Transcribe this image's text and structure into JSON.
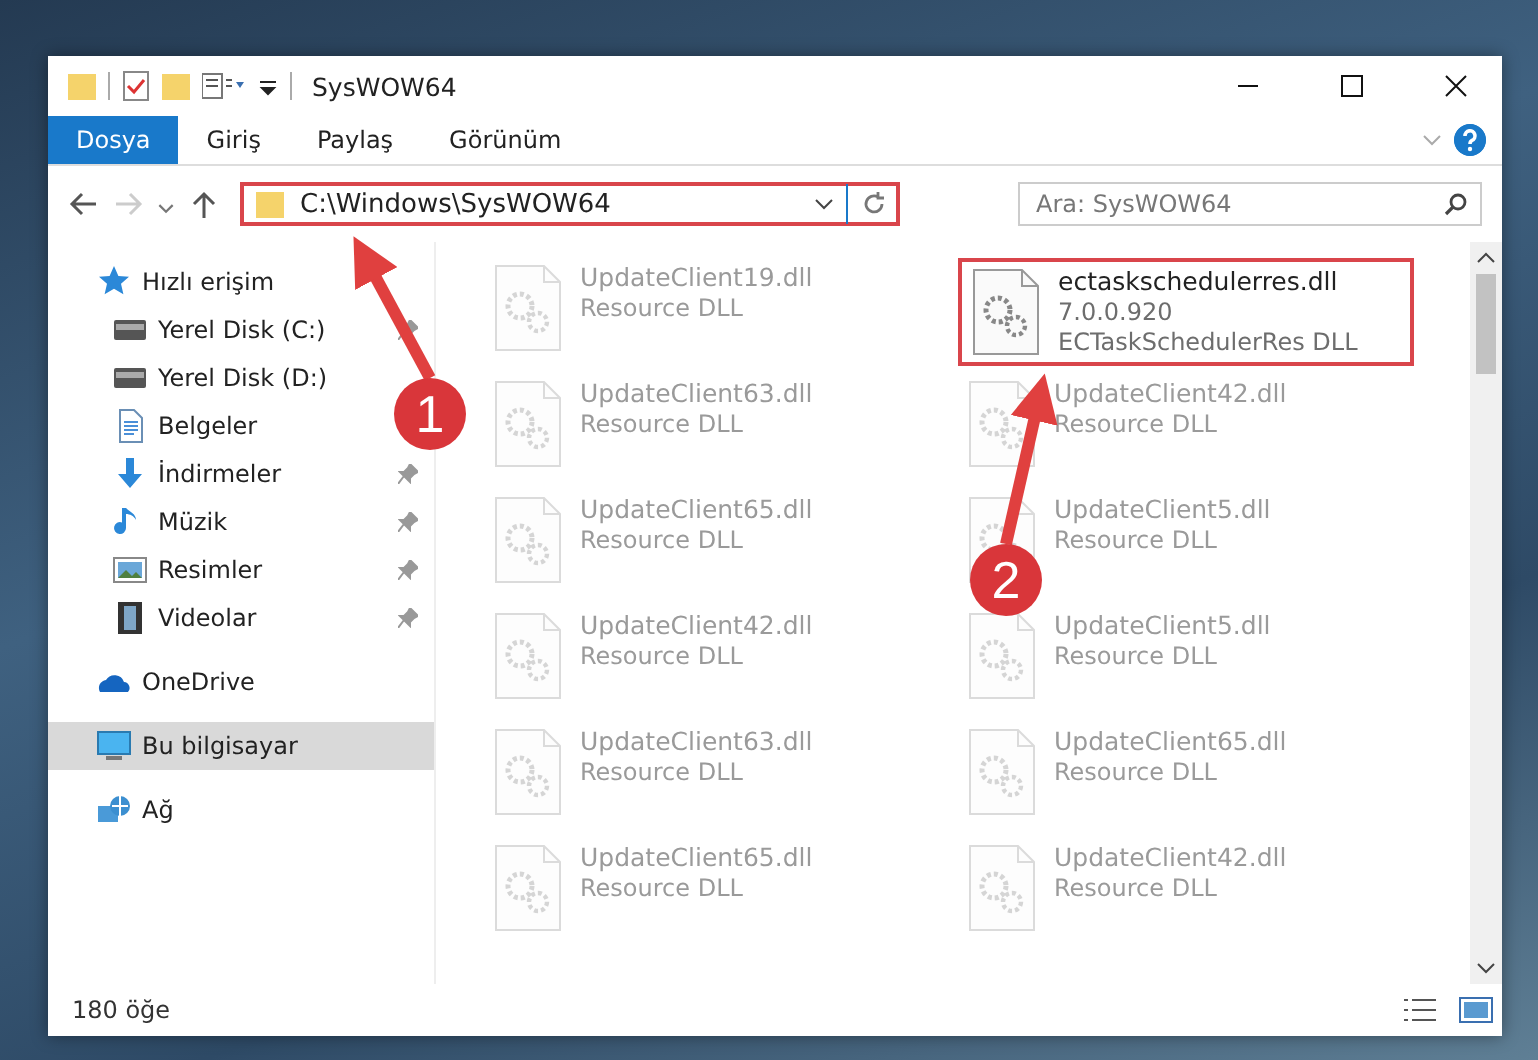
{
  "window": {
    "title": "SysWOW64"
  },
  "ribbon_tabs": [
    {
      "label": "Dosya",
      "selected": true
    },
    {
      "label": "Giriş",
      "selected": false
    },
    {
      "label": "Paylaş",
      "selected": false
    },
    {
      "label": "Görünüm",
      "selected": false
    }
  ],
  "address_bar": {
    "value": "C:\\Windows\\SysWOW64"
  },
  "search": {
    "placeholder": "Ara: SysWOW64"
  },
  "sidebar": {
    "items": [
      {
        "label": "Hızlı erişim",
        "kind": "star",
        "selected": false,
        "children": [
          {
            "label": "Yerel Disk (C:)",
            "kind": "drive",
            "pinned": true,
            "selected": false
          },
          {
            "label": "Yerel Disk (D:)",
            "kind": "drive",
            "pinned": false,
            "selected": false
          },
          {
            "label": "Belgeler",
            "kind": "docs",
            "pinned": false,
            "selected": false
          },
          {
            "label": "İndirmeler",
            "kind": "download",
            "pinned": true,
            "selected": false
          },
          {
            "label": "Müzik",
            "kind": "music",
            "pinned": true,
            "selected": false
          },
          {
            "label": "Resimler",
            "kind": "pictures",
            "pinned": true,
            "selected": false
          },
          {
            "label": "Videolar",
            "kind": "video",
            "pinned": true,
            "selected": false
          }
        ]
      },
      {
        "label": "OneDrive",
        "kind": "cloud",
        "selected": false
      },
      {
        "label": "Bu bilgisayar",
        "kind": "pc",
        "selected": true
      },
      {
        "label": "Ağ",
        "kind": "network",
        "selected": false
      }
    ]
  },
  "files": [
    {
      "name": "UpdateClient19.dll",
      "type": "Resource DLL",
      "faded": true
    },
    {
      "name": "ectaskschedulerres.dll",
      "version": "7.0.0.920",
      "type": "ECTaskSchedulerRes DLL",
      "faded": false
    },
    {
      "name": "UpdateClient63.dll",
      "type": "Resource DLL",
      "faded": true
    },
    {
      "name": "UpdateClient42.dll",
      "type": "Resource DLL",
      "faded": true
    },
    {
      "name": "UpdateClient65.dll",
      "type": "Resource DLL",
      "faded": true
    },
    {
      "name": "UpdateClient5.dll",
      "type": "Resource DLL",
      "faded": true
    },
    {
      "name": "UpdateClient42.dll",
      "type": "Resource DLL",
      "faded": true
    },
    {
      "name": "UpdateClient5.dll",
      "type": "Resource DLL",
      "faded": true
    },
    {
      "name": "UpdateClient63.dll",
      "type": "Resource DLL",
      "faded": true
    },
    {
      "name": "UpdateClient65.dll",
      "type": "Resource DLL",
      "faded": true
    },
    {
      "name": "UpdateClient65.dll",
      "type": "Resource DLL",
      "faded": true
    },
    {
      "name": "UpdateClient42.dll",
      "type": "Resource DLL",
      "faded": true
    }
  ],
  "status_bar": {
    "item_count": "180 öğe"
  },
  "annotations": [
    {
      "number": "1"
    },
    {
      "number": "2"
    }
  ]
}
